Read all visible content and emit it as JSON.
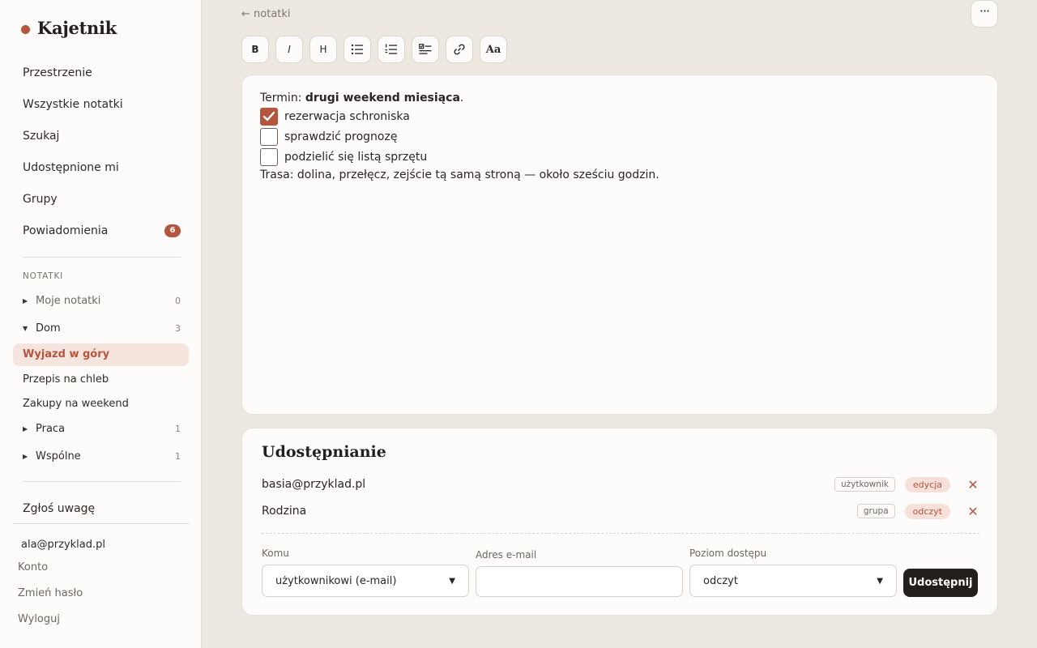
{
  "app": {
    "name": "Kajetnik"
  },
  "nav": {
    "items": [
      {
        "label": "Przestrzenie"
      },
      {
        "label": "Wszystkie notatki"
      },
      {
        "label": "Szukaj"
      },
      {
        "label": "Udostępnione mi"
      },
      {
        "label": "Grupy"
      },
      {
        "label": "Powiadomienia",
        "badge": "6"
      }
    ]
  },
  "notes_section": {
    "label": "NOTATKI",
    "tree": {
      "moje": {
        "label": "Moje notatki",
        "count": "0"
      },
      "dom": {
        "label": "Dom",
        "count": "3"
      },
      "praca": {
        "label": "Praca",
        "count": "1"
      },
      "wspolne": {
        "label": "Wspólne",
        "count": "1"
      }
    },
    "dom_notes": [
      {
        "label": "Wyjazd w góry",
        "active": true
      },
      {
        "label": "Przepis na chleb"
      },
      {
        "label": "Zakupy na weekend"
      }
    ]
  },
  "feedback": {
    "label": "Zgłoś uwagę"
  },
  "account": {
    "email": "ala@przyklad.pl",
    "links": [
      "Konto",
      "Zmień hasło",
      "Wyloguj"
    ]
  },
  "header": {
    "back_label": "← notatki",
    "more_icon": "more-horizontal-icon"
  },
  "toolbar": {
    "bold": "B",
    "italic": "I",
    "heading": "H",
    "aa": "Aa"
  },
  "editor": {
    "term_prefix": "Termin: ",
    "term_bold": "drugi weekend miesiąca",
    "term_suffix": ".",
    "checklist": [
      {
        "label": "rezerwacja schroniska",
        "checked": true
      },
      {
        "label": "sprawdzić prognozę",
        "checked": false
      },
      {
        "label": "podzielić się listą sprzętu",
        "checked": false
      }
    ],
    "route": "Trasa: dolina, przełęcz, zejście tą samą stroną — około sześciu godzin."
  },
  "sharing": {
    "title": "Udostępnianie",
    "entries": [
      {
        "who": "basia@przyklad.pl",
        "type": "użytkownik",
        "level": "edycja"
      },
      {
        "who": "Rodzina",
        "type": "grupa",
        "level": "odczyt"
      }
    ],
    "form": {
      "to_label": "Komu",
      "to_value": "użytkownikowi (e-mail)",
      "email_label": "Adres e-mail",
      "email_value": "",
      "level_label": "Poziom dostępu",
      "level_value": "odczyt",
      "submit": "Udostępnij"
    }
  },
  "colors": {
    "accent": "#b5553d",
    "background": "#ede9e0",
    "surface": "#fdfcfa",
    "dark_button": "#231f1c"
  }
}
